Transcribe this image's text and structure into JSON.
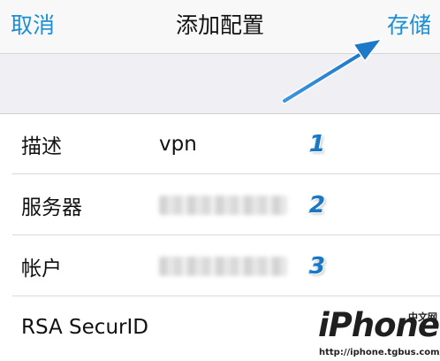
{
  "nav": {
    "cancel_label": "取消",
    "title": "添加配置",
    "save_label": "存储"
  },
  "rows": [
    {
      "label": "描述",
      "value": "vpn",
      "badge": "1"
    },
    {
      "label": "服务器",
      "value": "",
      "badge": "2"
    },
    {
      "label": "帐户",
      "value": "",
      "badge": "3"
    },
    {
      "label": "RSA SecurID"
    }
  ],
  "watermark": {
    "brand": "iPhone",
    "brand_cn": "中文网",
    "url": "http://iphone.tgbus.com/"
  },
  "colors": {
    "accent": "#1a8fd6",
    "annotation_arrow": "#2a86d4",
    "grouped_background": "#efeff4"
  },
  "icons": {
    "arrow": "annotation-arrow-pointing-to-save"
  }
}
